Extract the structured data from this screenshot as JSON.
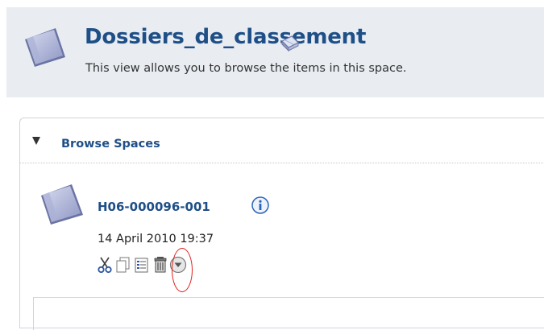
{
  "header": {
    "title": "Dossiers_de_classement",
    "subtitle": "This view allows you to browse the items in this space.",
    "icons": {
      "space": "folder-icon",
      "help": "book-icon"
    }
  },
  "browse_panel": {
    "title": "Browse Spaces",
    "collapse_icon": "triangle-down-icon",
    "items": [
      {
        "name": "H06-000096-001",
        "modified": "14 April 2010 19:37",
        "icons": [
          "folder-icon",
          "info-icon"
        ],
        "actions": [
          "cut-icon",
          "copy-icon",
          "details-icon",
          "delete-icon",
          "more-actions-icon"
        ],
        "highlighted_action": "delete-icon"
      }
    ]
  },
  "colors": {
    "title_blue": "#1f4f87",
    "header_bg": "#e9edf2",
    "highlight_red": "#e0201c"
  }
}
